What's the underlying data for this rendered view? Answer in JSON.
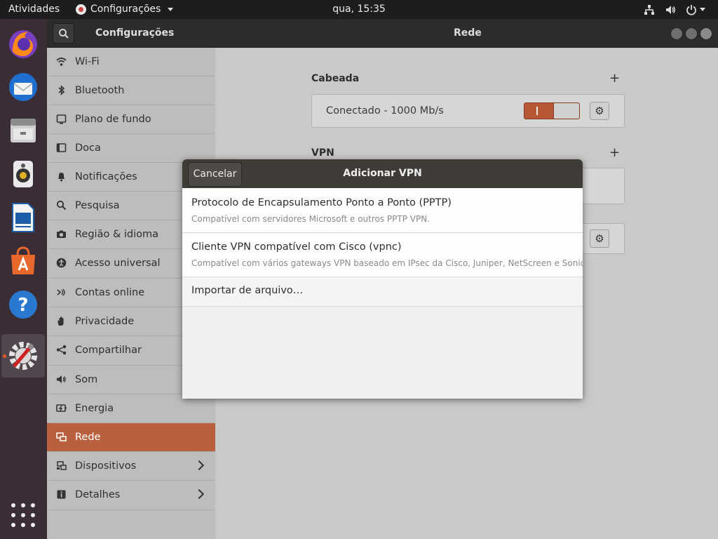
{
  "topbar": {
    "activities": "Atividades",
    "app_menu": "Configurações",
    "clock": "qua, 15:35"
  },
  "dock": {
    "items": [
      "firefox-icon",
      "thunderbird-icon",
      "files-icon",
      "rhythmbox-icon",
      "libreoffice-writer-icon",
      "software-icon",
      "help-icon",
      "settings-icon"
    ],
    "active": "settings-icon"
  },
  "window": {
    "left_title": "Configurações",
    "right_title": "Rede"
  },
  "sidebar": {
    "items": [
      {
        "label": "Wi-Fi",
        "icon": "wifi-icon"
      },
      {
        "label": "Bluetooth",
        "icon": "bluetooth-icon"
      },
      {
        "label": "Plano de fundo",
        "icon": "background-icon"
      },
      {
        "label": "Doca",
        "icon": "dock-icon"
      },
      {
        "label": "Notificações",
        "icon": "bell-icon"
      },
      {
        "label": "Pesquisa",
        "icon": "search-icon"
      },
      {
        "label": "Região & idioma",
        "icon": "camera-icon"
      },
      {
        "label": "Acesso universal",
        "icon": "accessibility-icon"
      },
      {
        "label": "Contas online",
        "icon": "online-accounts-icon"
      },
      {
        "label": "Privacidade",
        "icon": "hand-icon"
      },
      {
        "label": "Compartilhar",
        "icon": "share-icon"
      },
      {
        "label": "Som",
        "icon": "speaker-icon"
      },
      {
        "label": "Energia",
        "icon": "power-icon"
      },
      {
        "label": "Rede",
        "icon": "network-icon"
      },
      {
        "label": "Dispositivos",
        "icon": "devices-icon"
      },
      {
        "label": "Detalhes",
        "icon": "info-icon"
      }
    ],
    "active_index": 13
  },
  "main": {
    "wired_title": "Cabeada",
    "wired_status": "Conectado - 1000 Mb/s",
    "wired_switch_on": true,
    "vpn_title": "VPN"
  },
  "dialog": {
    "title": "Adicionar VPN",
    "cancel": "Cancelar",
    "options": [
      {
        "title": "Protocolo de Encapsulamento Ponto a Ponto (PPTP)",
        "desc": "Compatível com servidores Microsoft e outros PPTP VPN."
      },
      {
        "title": "Cliente VPN compatível com Cisco (vpnc)",
        "desc": "Compatível com vários gateways VPN baseado em IPsec da Cisco, Juniper, NetScreen e SonicWALL."
      },
      {
        "title": "Importar de arquivo…",
        "desc": ""
      }
    ]
  },
  "colors": {
    "accent": "#b9603f",
    "switch_on": "#b65735",
    "topbar": "#1d1d1d",
    "dock": "#3a2d36"
  }
}
